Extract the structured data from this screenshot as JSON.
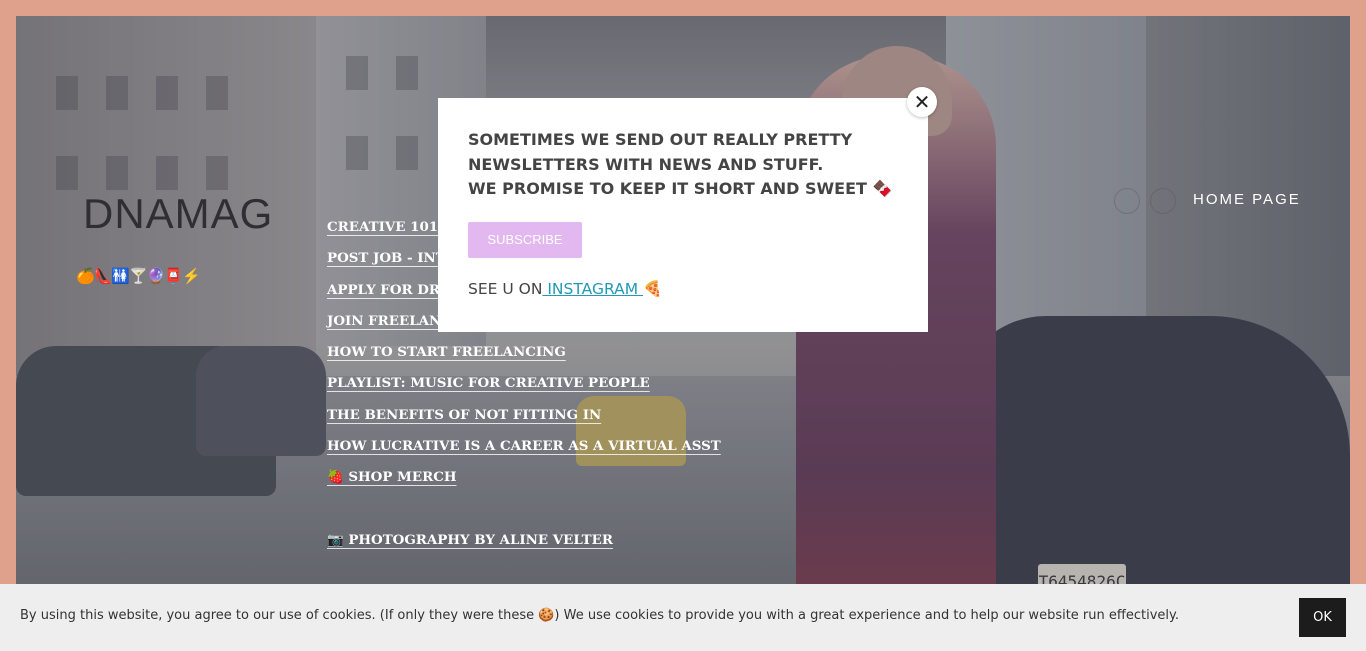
{
  "site": {
    "logo": "DNAMAG",
    "emoji_row": "🍊👠🚻🍸🔮📮⚡",
    "home_page_label": "HOME PAGE"
  },
  "nav": {
    "items": [
      "CREATIVE 101",
      "POST JOB - INT",
      "APPLY FOR DRE",
      "JOIN FREELANC",
      "HOW TO START FREELANCING",
      "PLAYLIST: MUSIC FOR CREATIVE PEOPLE",
      "THE BENEFITS OF NOT FITTING IN",
      "HOW LUCRATIVE IS A CAREER AS A VIRTUAL ASST",
      "🍓 SHOP MERCH",
      "📷 PHOTOGRAPHY BY ALINE VELTER"
    ]
  },
  "popup": {
    "line1": "SOMETIMES WE SEND OUT REALLY PRETTY",
    "line2": "NEWSLETTERS WITH NEWS AND STUFF.",
    "line3": "WE PROMISE TO KEEP IT SHORT AND SWEET 🍫",
    "subscribe_label": "SUBSCRIBE",
    "see_prefix": "SEE U ON",
    "instagram_label": " INSTAGRAM ",
    "pizza": "🍕",
    "close_symbol": "✕"
  },
  "cookie": {
    "text": "By using this website, you agree to our use of cookies. (If only they were these 🍪) We use cookies to provide you with a great experience and to help our website run effectively.",
    "ok_label": "OK"
  },
  "plate_text": "T6454826C",
  "colors": {
    "page_border": "#dfa08c",
    "subscribe_bg": "#e3b8f0",
    "instagram_link": "#2299b5",
    "ok_bg": "#1c1c1c"
  }
}
